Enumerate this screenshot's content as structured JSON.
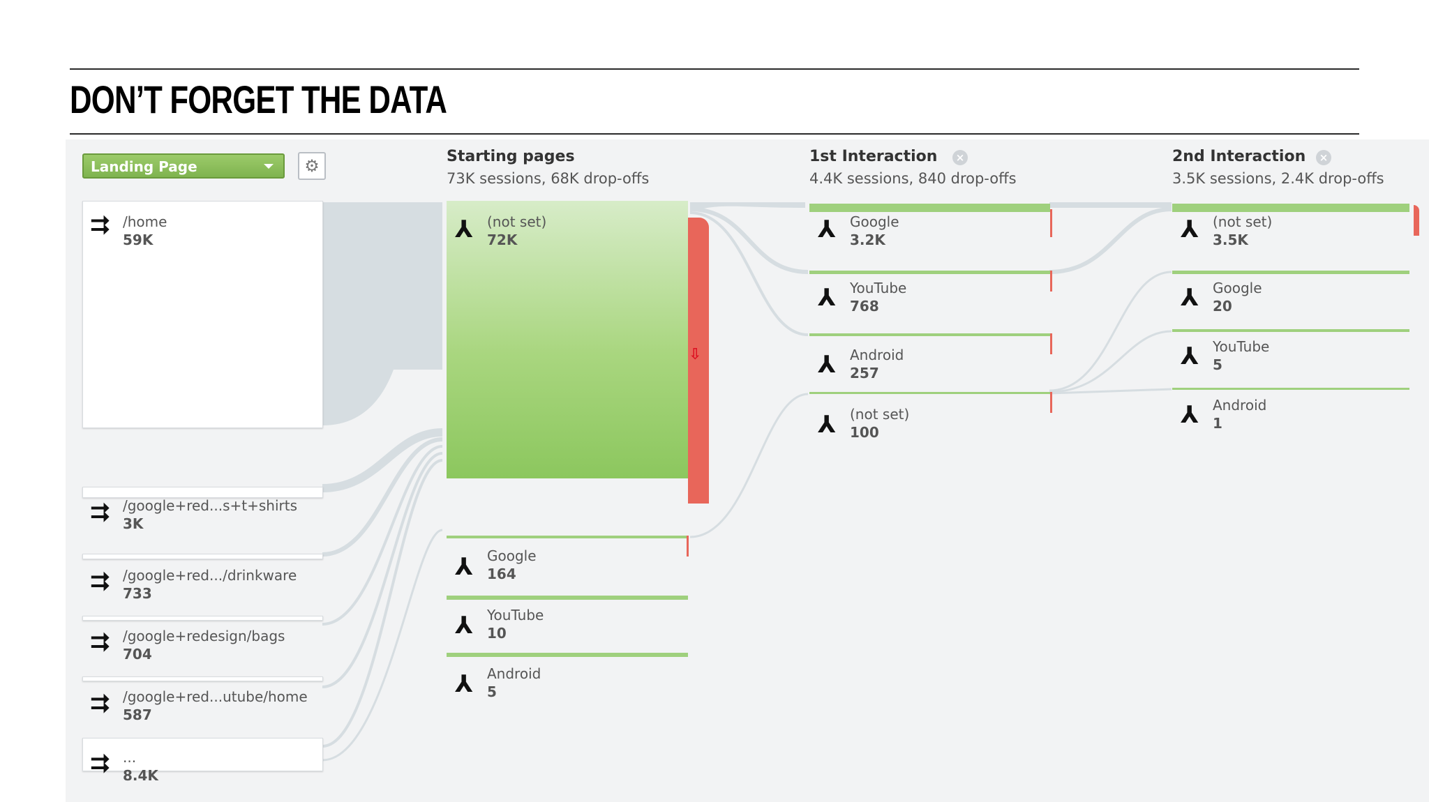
{
  "slide": {
    "title": "DON’T FORGET THE DATA"
  },
  "controls": {
    "dimension": "Landing Page"
  },
  "columns": [
    {
      "title": "Starting pages",
      "sub": "73K sessions, 68K drop-offs"
    },
    {
      "title": "1st Interaction",
      "sub": "4.4K sessions, 840 drop-offs"
    },
    {
      "title": "2nd Interaction",
      "sub": "3.5K sessions, 2.4K drop-offs"
    }
  ],
  "landing_pages": [
    {
      "label": "/home",
      "value": "59K"
    },
    {
      "label": "/google+red...s+t+shirts",
      "value": "3K"
    },
    {
      "label": "/google+red.../drinkware",
      "value": "733"
    },
    {
      "label": "/google+redesign/bags",
      "value": "704"
    },
    {
      "label": "/google+red...utube/home",
      "value": "587"
    },
    {
      "label": "...",
      "value": "8.4K"
    }
  ],
  "starting_pages": [
    {
      "label": "(not set)",
      "value": "72K"
    },
    {
      "label": "Google",
      "value": "164"
    },
    {
      "label": "YouTube",
      "value": "10"
    },
    {
      "label": "Android",
      "value": "5"
    }
  ],
  "first_interaction": [
    {
      "label": "Google",
      "value": "3.2K"
    },
    {
      "label": "YouTube",
      "value": "768"
    },
    {
      "label": "Android",
      "value": "257"
    },
    {
      "label": "(not set)",
      "value": "100"
    }
  ],
  "second_interaction": [
    {
      "label": "(not set)",
      "value": "3.5K"
    },
    {
      "label": "Google",
      "value": "20"
    },
    {
      "label": "YouTube",
      "value": "5"
    },
    {
      "label": "Android",
      "value": "1"
    }
  ],
  "icons": {
    "landing": "enter-arrow-icon",
    "node": "branch-icon",
    "gear": "gear-icon",
    "close": "close-icon",
    "drop": "drop-off-arrow-icon"
  },
  "colors": {
    "node_green": "#9fd07d",
    "dropoff_red": "#e8665a",
    "link": "#d6dde1",
    "dimension_green": "#8dbf5c"
  }
}
